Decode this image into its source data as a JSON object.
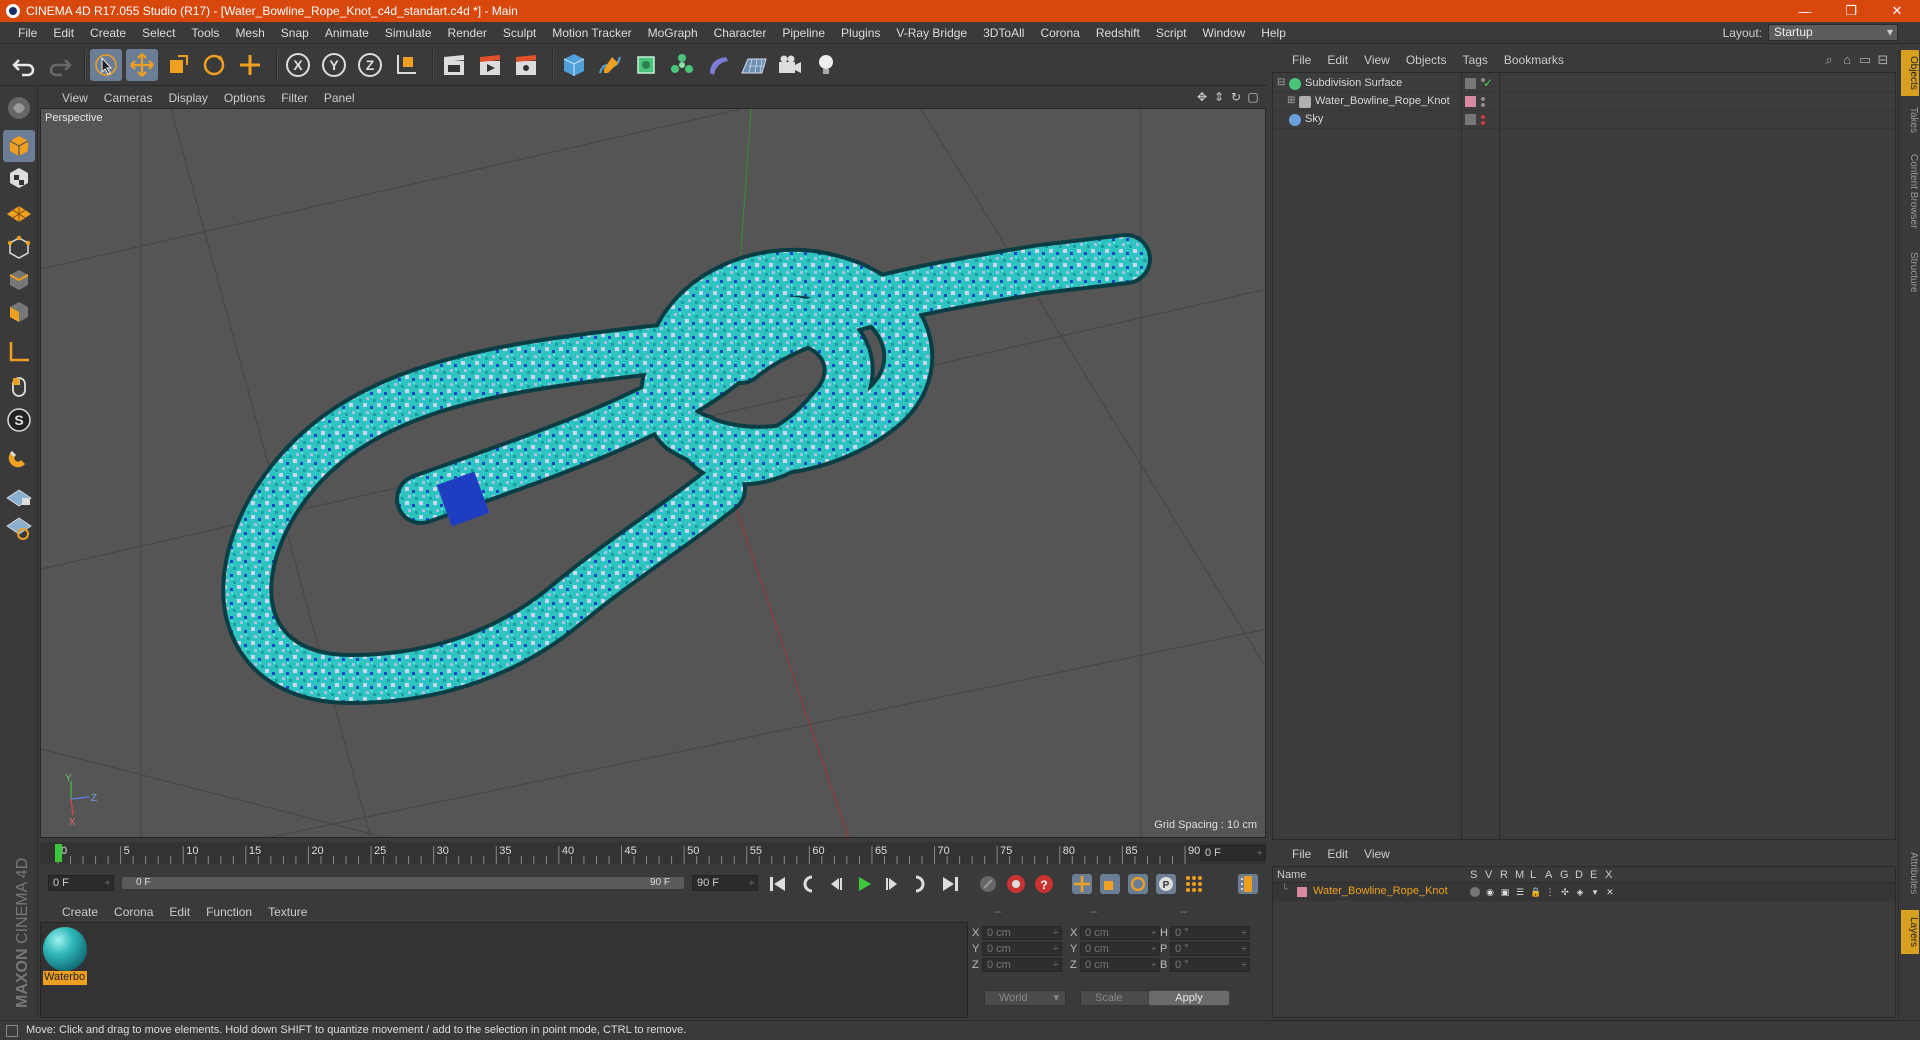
{
  "window": {
    "title": "CINEMA 4D R17.055 Studio (R17) - [Water_Bowline_Rope_Knot_c4d_standart.c4d *] - Main",
    "minimize": "—",
    "restore": "❐",
    "close": "✕"
  },
  "menubar": {
    "items": [
      "File",
      "Edit",
      "Create",
      "Select",
      "Tools",
      "Mesh",
      "Snap",
      "Animate",
      "Simulate",
      "Render",
      "Sculpt",
      "Motion Tracker",
      "MoGraph",
      "Character",
      "Pipeline",
      "Plugins",
      "V-Ray Bridge",
      "3DToAll",
      "Corona",
      "Redshift",
      "Script",
      "Window",
      "Help"
    ],
    "layout_label": "Layout:",
    "layout_value": "Startup"
  },
  "toolbar": {
    "axis_x": "X",
    "axis_y": "Y",
    "axis_z": "Z"
  },
  "viewport": {
    "menu": [
      "View",
      "Cameras",
      "Display",
      "Options",
      "Filter",
      "Panel"
    ],
    "label": "Perspective",
    "grid_spacing": "Grid Spacing : 10 cm",
    "axis_labels": {
      "y": "Y",
      "z": "Z",
      "x": "X"
    }
  },
  "timeline": {
    "ticks": [
      "0",
      "5",
      "10",
      "15",
      "20",
      "25",
      "30",
      "35",
      "40",
      "45",
      "50",
      "55",
      "60",
      "65",
      "70",
      "75",
      "80",
      "85",
      "90"
    ],
    "current_frame": "0 F",
    "start_field": "0 F",
    "scrub_start": "0 F",
    "scrub_end": "90 F",
    "end_field": "90 F"
  },
  "material_manager": {
    "menu": [
      "Create",
      "Corona",
      "Edit",
      "Function",
      "Texture"
    ],
    "materials": [
      {
        "name": "Waterbo"
      }
    ]
  },
  "coordinates": {
    "headers": [
      "--",
      "--",
      "--"
    ],
    "rows": [
      {
        "l1": "X",
        "v1": "0 cm",
        "l2": "X",
        "v2": "0 cm",
        "l3": "H",
        "v3": "0 °"
      },
      {
        "l1": "Y",
        "v1": "0 cm",
        "l2": "Y",
        "v2": "0 cm",
        "l3": "P",
        "v3": "0 °"
      },
      {
        "l1": "Z",
        "v1": "0 cm",
        "l2": "Z",
        "v2": "0 cm",
        "l3": "B",
        "v3": "0 °"
      }
    ],
    "space": "World",
    "mode": "Scale",
    "apply": "Apply"
  },
  "object_manager": {
    "menu": [
      "File",
      "Edit",
      "View",
      "Objects",
      "Tags",
      "Bookmarks"
    ],
    "objects": [
      {
        "name": "Subdivision Surface",
        "icon_color": "#49c47a"
      },
      {
        "name": "Water_Bowline_Rope_Knot",
        "icon_color": "#b0b0b0"
      },
      {
        "name": "Sky",
        "icon_color": "#6aa0d8"
      }
    ]
  },
  "layer_manager": {
    "menu": [
      "File",
      "Edit",
      "View"
    ],
    "columns": [
      "Name",
      "S",
      "V",
      "R",
      "M",
      "L",
      "A",
      "G",
      "D",
      "E",
      "X"
    ],
    "layers": [
      {
        "name": "Water_Bowline_Rope_Knot",
        "color": "#d98aa0"
      }
    ]
  },
  "side_tabs": [
    "Objects",
    "Takes",
    "Content Browser",
    "Structure",
    "Attributes",
    "Layers"
  ],
  "status": "Move: Click and drag to move elements. Hold down SHIFT to quantize movement / add to the selection in point mode, CTRL to remove.",
  "colors": {
    "accent": "#d8480d",
    "rope": "#2ec9c6",
    "highlight": "#f0a020"
  },
  "branding": {
    "line1": "MAXON",
    "line2": "CINEMA 4D"
  }
}
